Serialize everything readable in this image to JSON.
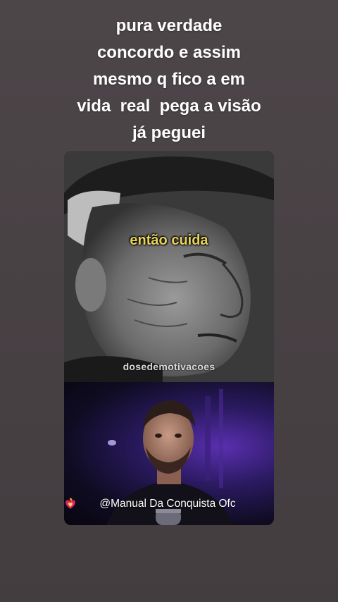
{
  "story": {
    "caption_lines": [
      "pura verdade",
      "concordo e assim",
      "mesmo q fico a em",
      "vida  real  pega a visão",
      "já peguei"
    ]
  },
  "video": {
    "subtitle": "então cuida",
    "watermark": "dosedemotivacoes",
    "credit": "@Manual Da Conquista Ofc",
    "credit_icon": "heart-on-fire-icon"
  },
  "colors": {
    "background": "#4a4346",
    "caption_text": "#ffffff",
    "subtitle_text": "#e8d35a",
    "accent_purple": "#5a2fb0"
  }
}
